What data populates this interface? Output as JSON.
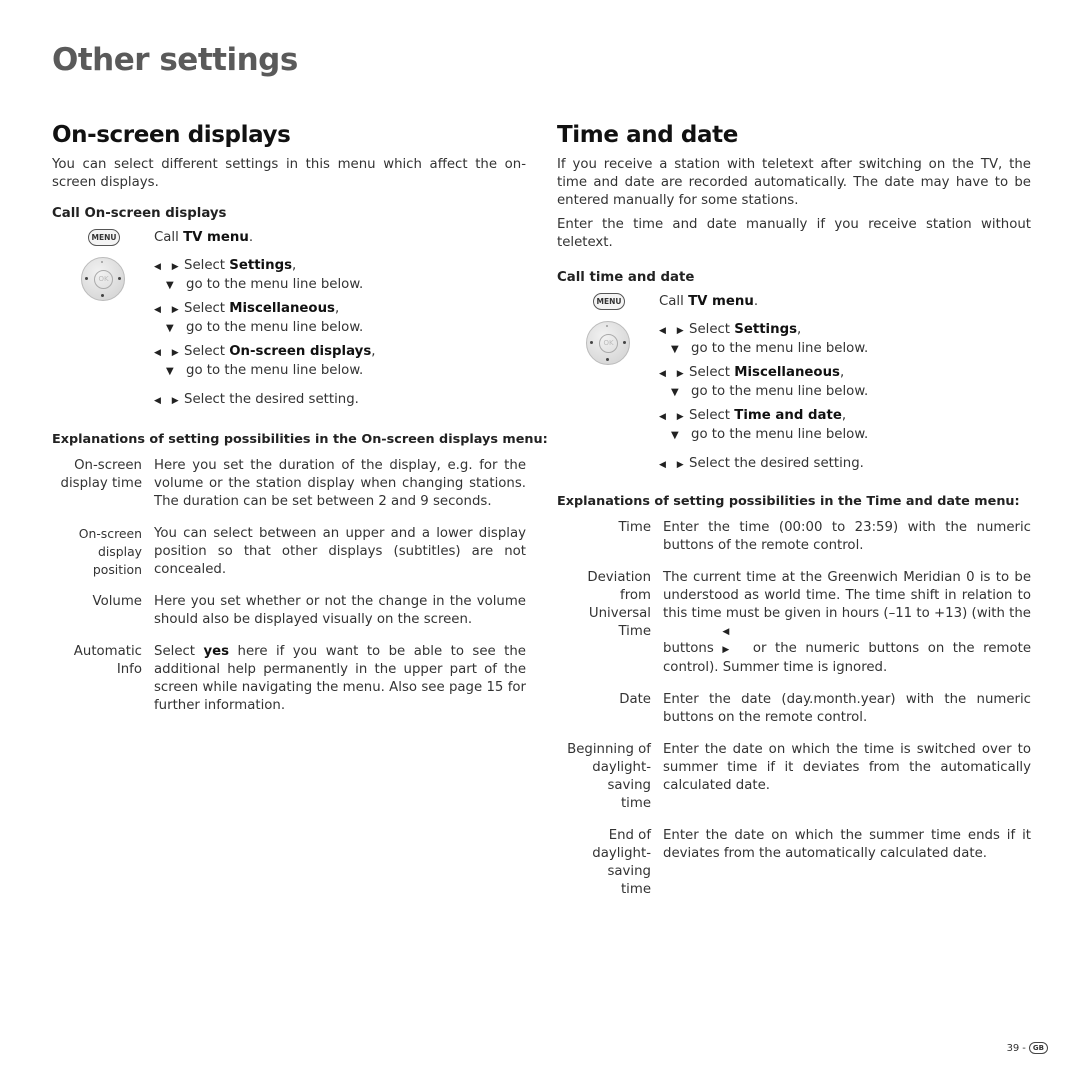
{
  "page": {
    "title": "Other settings",
    "page_number": "39",
    "page_sep": "-",
    "country_badge": "GB"
  },
  "left": {
    "heading": "On-screen displays",
    "intro": "You can select different settings in this menu which affect the on-screen displays.",
    "call_heading": "Call On-screen displays",
    "menu_button": "MENU",
    "ok_button": "OK",
    "steps": {
      "call_pre": "Call ",
      "call_bold": "TV menu",
      "call_post": ".",
      "select": "Select ",
      "s1_bold": "Settings",
      "s2_bold": "Miscellaneous",
      "s3_bold": "On-screen displays",
      "comma": ",",
      "go_below": "go to the menu line below.",
      "select_desired": "Select the desired setting."
    },
    "explanations_heading": "Explanations of setting possibilities in the On-screen displays menu:",
    "definitions": [
      {
        "term_1": "On-screen",
        "term_2": "display time",
        "desc": "Here you set the duration of the display, e.g. for the volume or the station display when changing stations. The duration can be set between 2 and 9 seconds."
      },
      {
        "term_1": "On-screen",
        "term_2": "display position",
        "desc": "You can select between an upper and a lower display position so that other displays (subtitles) are not concealed."
      },
      {
        "term_1": "Volume",
        "term_2": "",
        "desc": "Here you set whether or not the change in the volume should also be displayed visually on the screen."
      },
      {
        "term_1": "Automatic",
        "term_2": "Info",
        "desc_pre": "Select ",
        "desc_bold": "yes",
        "desc_post": " here if you want to be able to see the additional help permanently in the upper part of the screen while navigating the menu. Also see page 15 for further information."
      }
    ]
  },
  "right": {
    "heading": "Time and date",
    "intro_1": "If you receive a station with teletext after switching on the TV, the time and date are recorded automatically. The date may have to be entered manually for some stations.",
    "intro_2": "Enter the time and date manually if you receive station without teletext.",
    "call_heading": "Call time and date",
    "menu_button": "MENU",
    "ok_button": "OK",
    "steps": {
      "call_pre": "Call ",
      "call_bold": "TV menu",
      "call_post": ".",
      "select": "Select ",
      "s1_bold": "Settings",
      "s2_bold": "Miscellaneous",
      "s3_bold": "Time and date",
      "comma": ",",
      "go_below": "go to the menu line below.",
      "select_desired": "Select the desired setting."
    },
    "explanations_heading": "Explanations of setting possibilities in the Time and date menu:",
    "definitions": [
      {
        "term_1": "Time",
        "term_2": "",
        "term_3": "",
        "desc": "Enter the time (00:00 to 23:59) with the numeric buttons of the remote control."
      },
      {
        "term_1": "Deviation from",
        "term_2": "Universal Time",
        "term_3": "",
        "desc_pre": "The current time at the Greenwich Meridian 0 is to be understood as world time. The time shift in relation to this time must be given in hours (–11 to +13) (with the buttons ",
        "desc_post": " or the numeric buttons on the remote control). Summer time is ignored."
      },
      {
        "term_1": "Date",
        "term_2": "",
        "term_3": "",
        "desc": "Enter the date (day.month.year) with the numeric buttons on the remote control."
      },
      {
        "term_1": "Beginning of",
        "term_2": "daylight-saving",
        "term_3": "time",
        "desc": "Enter the date on which the time is switched over to summer time if it deviates from the automatically calculated date."
      },
      {
        "term_1": "End of",
        "term_2": "daylight-saving",
        "term_3": "time",
        "desc": "Enter the date on which the summer time ends if it deviates from the automatically calculated date."
      }
    ]
  },
  "icons": {
    "left_right_arrows": "◀ ▶",
    "down_arrow": "▼"
  }
}
